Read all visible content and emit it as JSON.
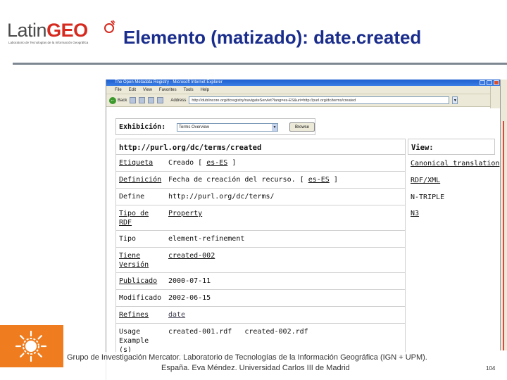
{
  "slide": {
    "logo_latin": "Latin",
    "logo_geo": "GEO",
    "logo_subtitle": "Laboratorio de Tecnologías de la Información Geográfica",
    "title": "Elemento (matizado): date.created",
    "footer_line1": "Grupo de Investigación Mercator. Laboratorio de Tecnologías de la Información Geográfica (IGN + UPM).",
    "footer_line2": "España.  Eva Méndez. Universidad Carlos III de Madrid",
    "page_number": "104",
    "accent_title_color": "#1a2d8c",
    "accent_orange": "#ef7d1f",
    "accent_red": "#d62a1f"
  },
  "browser": {
    "window_title": "The Open Metadata Registry - Microsoft Internet Explorer",
    "menu": [
      "File",
      "Edit",
      "View",
      "Favorites",
      "Tools",
      "Help"
    ],
    "back_label": "Back",
    "address_label": "Address",
    "address_value": "http://dublincore.org/dcregistry/navigateServlet?lang=es-ES&uri=http://purl.org/dc/terms/created"
  },
  "exhibition": {
    "label": "Exhibición:",
    "selected": "Terms Overview",
    "button": "Browse"
  },
  "term": {
    "uri": "http://purl.org/dc/terms/created",
    "rows": {
      "etiqueta": {
        "label": "Etiqueta",
        "value": "Creado [ ",
        "lang": "es-ES",
        "close": " ]"
      },
      "definicion": {
        "label": "Definición",
        "value": "Fecha de creación del recurso. [ ",
        "lang": "es-ES",
        "close": " ]"
      },
      "define": {
        "label": "Define",
        "value": "http://purl.org/dc/terms/"
      },
      "tipo_rdf": {
        "label_1": "Tipo de",
        "label_2": "RDF",
        "value": "Property"
      },
      "tipo": {
        "label": "Tipo",
        "value": "element-refinement"
      },
      "tiene_version": {
        "label_1": "Tiene",
        "label_2": "Versión",
        "value": "created-002"
      },
      "publicado": {
        "label": "Publicado",
        "value": "2000-07-11"
      },
      "modificado": {
        "label": "Modificado",
        "value": "2002-06-15"
      },
      "refines": {
        "label": "Refines",
        "value": "date"
      },
      "usage": {
        "label_1": "Usage",
        "label_2": "Example",
        "label_3": "(s)",
        "value_1": "created-001.rdf",
        "value_2": "created-002.rdf"
      }
    }
  },
  "view_panel": {
    "heading": "View:",
    "items": [
      "Canonical translation",
      "RDF/XML",
      "N-TRIPLE",
      "N3"
    ]
  }
}
